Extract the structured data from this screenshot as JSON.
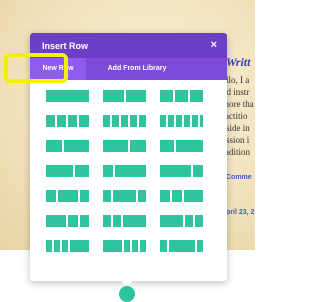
{
  "background": {
    "heading": "Writt",
    "lines": [
      "ello, I a",
      "nd instr",
      "more tha",
      "ractitio",
      "eside in",
      "assion i",
      "radition"
    ],
    "comment_link": "Comme",
    "date_link": "pril 23, 2"
  },
  "modal": {
    "title": "Insert Row",
    "close_glyph": "×",
    "tabs": [
      {
        "label": "New Row",
        "active": true
      },
      {
        "label": "Add From Library",
        "active": false
      }
    ]
  },
  "layouts": [
    {
      "label": "1 column",
      "cols": [
        1
      ]
    },
    {
      "label": "1/2 + 1/2",
      "cols": [
        1,
        1
      ]
    },
    {
      "label": "1/3 x 3",
      "cols": [
        1,
        1,
        1
      ]
    },
    {
      "label": "1/4 x 4",
      "cols": [
        1,
        1,
        1,
        1
      ]
    },
    {
      "label": "1/5 x 5",
      "cols": [
        1,
        1,
        1,
        1,
        1
      ]
    },
    {
      "label": "1/6 x 6",
      "cols": [
        1,
        1,
        1,
        1,
        1,
        1
      ]
    },
    {
      "label": "2/5 + 3/5",
      "cols": [
        2,
        3
      ]
    },
    {
      "label": "3/5 + 2/5",
      "cols": [
        3,
        2
      ]
    },
    {
      "label": "1/3 + 2/3",
      "cols": [
        1,
        2
      ]
    },
    {
      "label": "2/3 + 1/3",
      "cols": [
        2,
        1
      ]
    },
    {
      "label": "1/4 + 3/4",
      "cols": [
        1,
        3
      ]
    },
    {
      "label": "3/4 + 1/4",
      "cols": [
        3,
        1
      ]
    },
    {
      "label": "1/4 + 1/2 + 1/4",
      "cols": [
        1,
        2,
        1
      ]
    },
    {
      "label": "1/5 + 3/5 + 1/5",
      "cols": [
        1,
        3,
        1
      ]
    },
    {
      "label": "1/4 + 1/4 + 1/2",
      "cols": [
        1,
        1,
        2
      ]
    },
    {
      "label": "1/2 + 1/4 + 1/4",
      "cols": [
        2,
        1,
        1
      ]
    },
    {
      "label": "1/5 + 1/5 + 3/5",
      "cols": [
        1,
        1,
        3
      ]
    },
    {
      "label": "3/5 + 1/5 + 1/5",
      "cols": [
        3,
        1,
        1
      ]
    },
    {
      "label": "1/6 + 1/6 + 1/6 + 1/2",
      "cols": [
        1,
        1,
        1,
        3
      ]
    },
    {
      "label": "1/2 + 1/6 + 1/6 + 1/6",
      "cols": [
        3,
        1,
        1,
        1
      ]
    },
    {
      "label": "1/6 + 2/3 + 1/6",
      "cols": [
        1,
        4,
        1
      ]
    }
  ],
  "colors": {
    "header": "#6c3fc7",
    "tabbar": "#7d4bd9",
    "accent": "#2fc39f",
    "highlight": "#f2ee0d"
  }
}
